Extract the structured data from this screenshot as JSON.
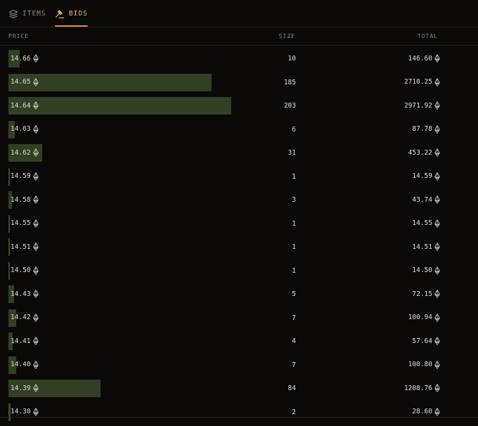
{
  "tabs": {
    "items_label": "ITEMS",
    "bids_label": "BIDS",
    "active": "bids"
  },
  "columns": {
    "price": "PRICE",
    "size": "SIZE",
    "total": "TOTAL"
  },
  "colors": {
    "accent": "#f0b46a",
    "bar": "#313f23",
    "background": "#0a0908"
  },
  "currency_icon": "eth-icon",
  "max_size": 203,
  "bids": [
    {
      "price": "14.66",
      "size": "10",
      "total": "146.60",
      "size_value": 10
    },
    {
      "price": "14.65",
      "size": "185",
      "total": "2710.25",
      "size_value": 185
    },
    {
      "price": "14.64",
      "size": "203",
      "total": "2971.92",
      "size_value": 203
    },
    {
      "price": "14.63",
      "size": "6",
      "total": "87.78",
      "size_value": 6
    },
    {
      "price": "14.62",
      "size": "31",
      "total": "453.22",
      "size_value": 31
    },
    {
      "price": "14.59",
      "size": "1",
      "total": "14.59",
      "size_value": 1
    },
    {
      "price": "14.58",
      "size": "3",
      "total": "43.74",
      "size_value": 3
    },
    {
      "price": "14.55",
      "size": "1",
      "total": "14.55",
      "size_value": 1
    },
    {
      "price": "14.51",
      "size": "1",
      "total": "14.51",
      "size_value": 1
    },
    {
      "price": "14.50",
      "size": "1",
      "total": "14.50",
      "size_value": 1
    },
    {
      "price": "14.43",
      "size": "5",
      "total": "72.15",
      "size_value": 5
    },
    {
      "price": "14.42",
      "size": "7",
      "total": "100.94",
      "size_value": 7
    },
    {
      "price": "14.41",
      "size": "4",
      "total": "57.64",
      "size_value": 4
    },
    {
      "price": "14.40",
      "size": "7",
      "total": "100.80",
      "size_value": 7
    },
    {
      "price": "14.39",
      "size": "84",
      "total": "1208.76",
      "size_value": 84
    },
    {
      "price": "14.30",
      "size": "2",
      "total": "28.60",
      "size_value": 2
    }
  ]
}
